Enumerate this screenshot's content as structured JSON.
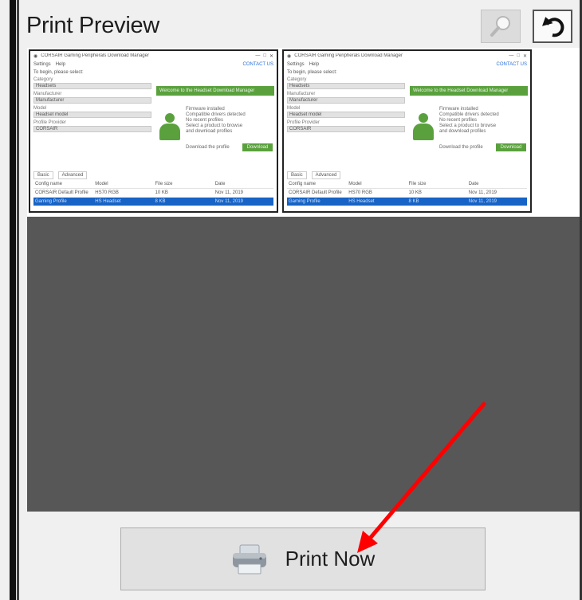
{
  "panel": {
    "title": "Print Preview",
    "zoom_button_icon": "magnifier-icon",
    "undo_button_icon": "undo-arrow-icon"
  },
  "preview": {
    "window_title": "CORSAIR Gaming Peripherals Download Manager",
    "menu": [
      "Settings",
      "Help"
    ],
    "menu_right": "CONTACT US",
    "prompt": "To begin, please select:",
    "fields": [
      {
        "label": "Category",
        "value": "Headsets"
      },
      {
        "label": "Manufacturer",
        "value": "Manufacturer"
      },
      {
        "label": "Model",
        "value": "Headset model"
      },
      {
        "label": "Profile Provider",
        "value": "CORSAIR"
      }
    ],
    "banner": "Welcome to the Headset Download Manager",
    "info_lines": [
      "Firmware installed",
      "Compatible drivers detected",
      "No recent profiles",
      "Select a product to browse",
      "and download profiles"
    ],
    "download_note": "Download the profile",
    "download_button": "Download",
    "tabs": [
      "Basic",
      "Advanced"
    ],
    "table_headers": [
      "Config name",
      "Model",
      "File size",
      "Date"
    ],
    "table_rows": [
      [
        "CORSAIR Default Profile",
        "HS70 RGB",
        "10 KB",
        "Nov 11, 2019"
      ],
      [
        "Gaming Profile",
        "HS Headset",
        "8 KB",
        "Nov 11, 2019"
      ]
    ]
  },
  "print_button": {
    "label": "Print Now",
    "icon": "printer-icon"
  },
  "annotation": {
    "color": "#ff0000",
    "shape": "arrow pointing to Print Now button"
  }
}
